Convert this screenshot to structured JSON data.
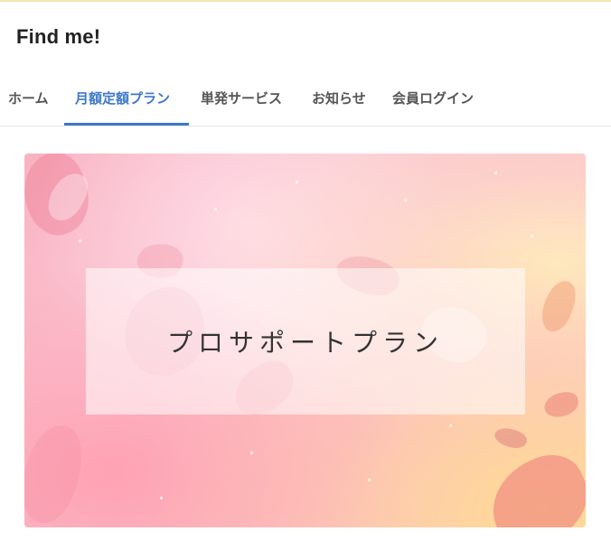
{
  "site": {
    "title": "Find me!"
  },
  "nav": {
    "items": [
      {
        "label": "ホーム",
        "active": false
      },
      {
        "label": "月額定額プラン",
        "active": true
      },
      {
        "label": "単発サービス",
        "active": false
      },
      {
        "label": "お知らせ",
        "active": false
      },
      {
        "label": "会員ログイン",
        "active": false
      }
    ]
  },
  "hero": {
    "heading": "プロサポートプラン"
  },
  "colors": {
    "accent": "#3d78c8",
    "nav_text": "#555555",
    "title_text": "#222222"
  }
}
